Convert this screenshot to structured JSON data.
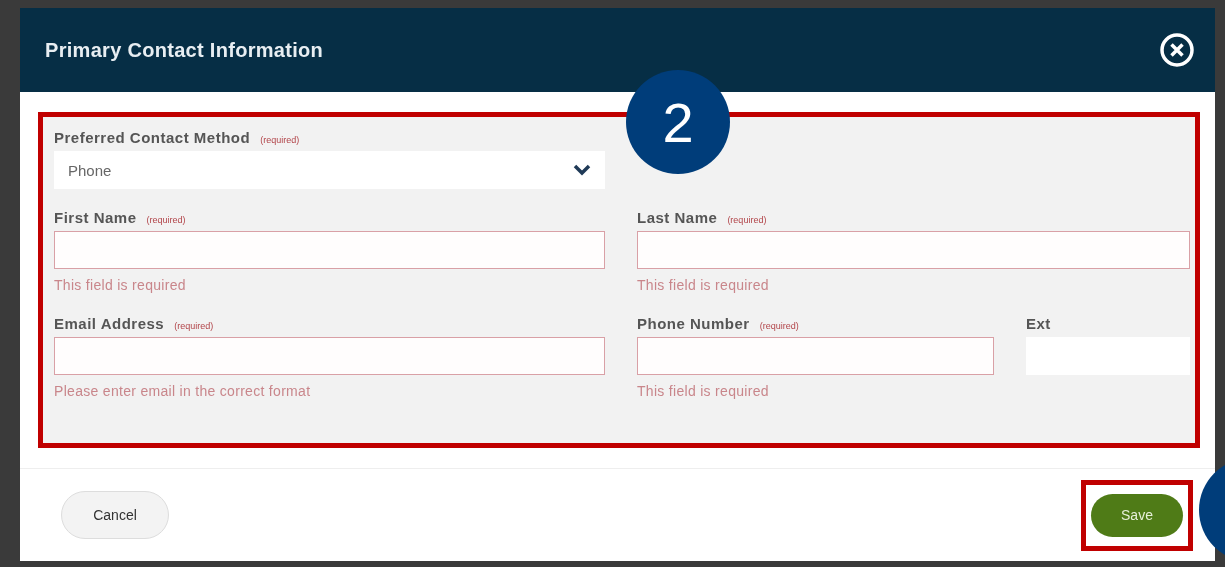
{
  "dialog": {
    "title": "Primary Contact Information"
  },
  "form": {
    "rows": [
      [
        {
          "kind": "select",
          "label": "Preferred Contact Method",
          "note": "(required)",
          "value": "Phone"
        }
      ],
      [
        {
          "kind": "text",
          "label": "First Name",
          "note": "(required)",
          "invalid": true,
          "error": "This field is required"
        },
        {
          "kind": "text",
          "label": "Last Name",
          "note": "(required)",
          "invalid": true,
          "error": "This field is required"
        }
      ],
      [
        {
          "kind": "text",
          "label": "Email Address",
          "note": "(required)",
          "invalid": true,
          "error": "Please enter email in the correct format"
        },
        {
          "kind": "text",
          "label": "Phone Number",
          "note": "(required)",
          "invalid": true,
          "error": "This field is required"
        },
        {
          "kind": "text",
          "label": "Ext",
          "invalid": false
        }
      ]
    ]
  },
  "buttons": {
    "cancel": "Cancel",
    "save": "Save"
  },
  "annotation": {
    "step": "2"
  }
}
